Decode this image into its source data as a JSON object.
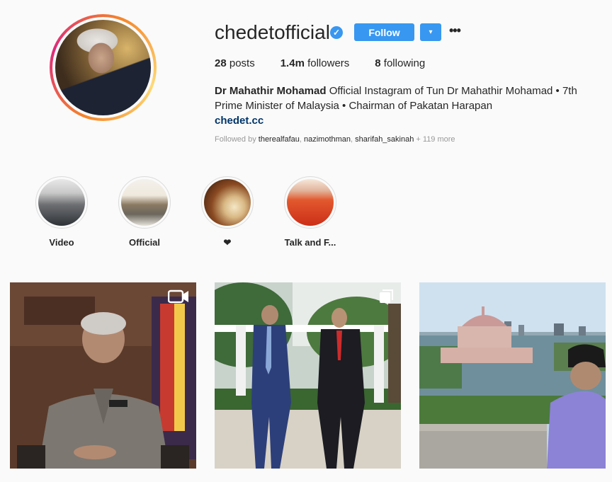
{
  "profile": {
    "username": "chedetofficial",
    "verified_icon": "verified-badge-icon",
    "follow_label": "Follow",
    "dropdown_icon": "▾",
    "more_icon": "•••"
  },
  "stats": {
    "posts_count": "28",
    "posts_label": "posts",
    "followers_count": "1.4m",
    "followers_label": "followers",
    "following_count": "8",
    "following_label": "following"
  },
  "bio": {
    "name": "Dr Mahathir Mohamad",
    "text": "Official Instagram of Tun Dr Mahathir Mohamad • 7th Prime Minister of Malaysia • Chairman of Pakatan Harapan",
    "link": "chedet.cc"
  },
  "followed_by": {
    "prefix": "Followed by",
    "users": [
      "therealfafau",
      "nazimothman",
      "sharifah_sakinah"
    ],
    "more": "+ 119 more"
  },
  "highlights": [
    {
      "label": "Video"
    },
    {
      "label": "Official"
    },
    {
      "label": "❤"
    },
    {
      "label": "Talk and F..."
    }
  ],
  "posts": [
    {
      "type": "video",
      "icon": "video-camera-icon"
    },
    {
      "type": "carousel",
      "icon": "multiple-photos-icon"
    },
    {
      "type": "photo",
      "icon": ""
    }
  ],
  "colors": {
    "accent": "#3897f0",
    "background": "#fafafa",
    "text": "#262626",
    "link": "#003569"
  }
}
